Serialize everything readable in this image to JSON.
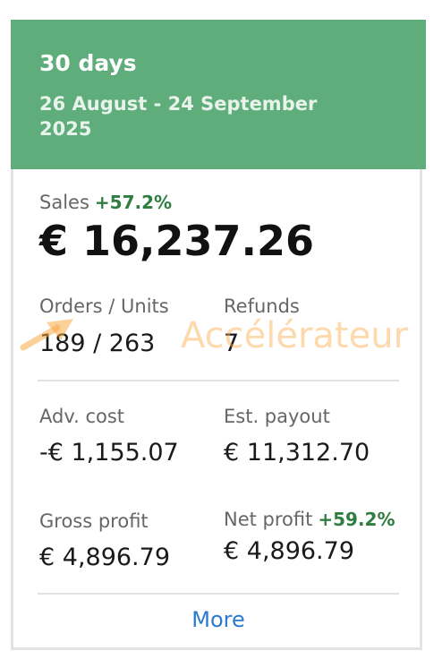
{
  "header": {
    "title": "30 days",
    "date_range": "26 August - 24 September 2025"
  },
  "sales": {
    "label": "Sales",
    "change": "+57.2%",
    "value": "€ 16,237.26"
  },
  "orders_units": {
    "label": "Orders / Units",
    "value": "189 / 263"
  },
  "refunds": {
    "label": "Refunds",
    "value": "7"
  },
  "adv_cost": {
    "label": "Adv. cost",
    "value": "-€ 1,155.07"
  },
  "est_payout": {
    "label": "Est. payout",
    "value": "€ 11,312.70"
  },
  "gross_profit": {
    "label": "Gross profit",
    "value": "€ 4,896.79"
  },
  "net_profit": {
    "label": "Net profit",
    "change": "+59.2%",
    "value": "€ 4,896.79"
  },
  "more_link": "More",
  "watermark": {
    "text": "Accélérateur",
    "icon": "arrow-up-right-icon"
  },
  "colors": {
    "header_bg": "#5fad7b",
    "positive": "#2f7d40",
    "link": "#2a7ad2",
    "watermark": "#faaa46"
  }
}
